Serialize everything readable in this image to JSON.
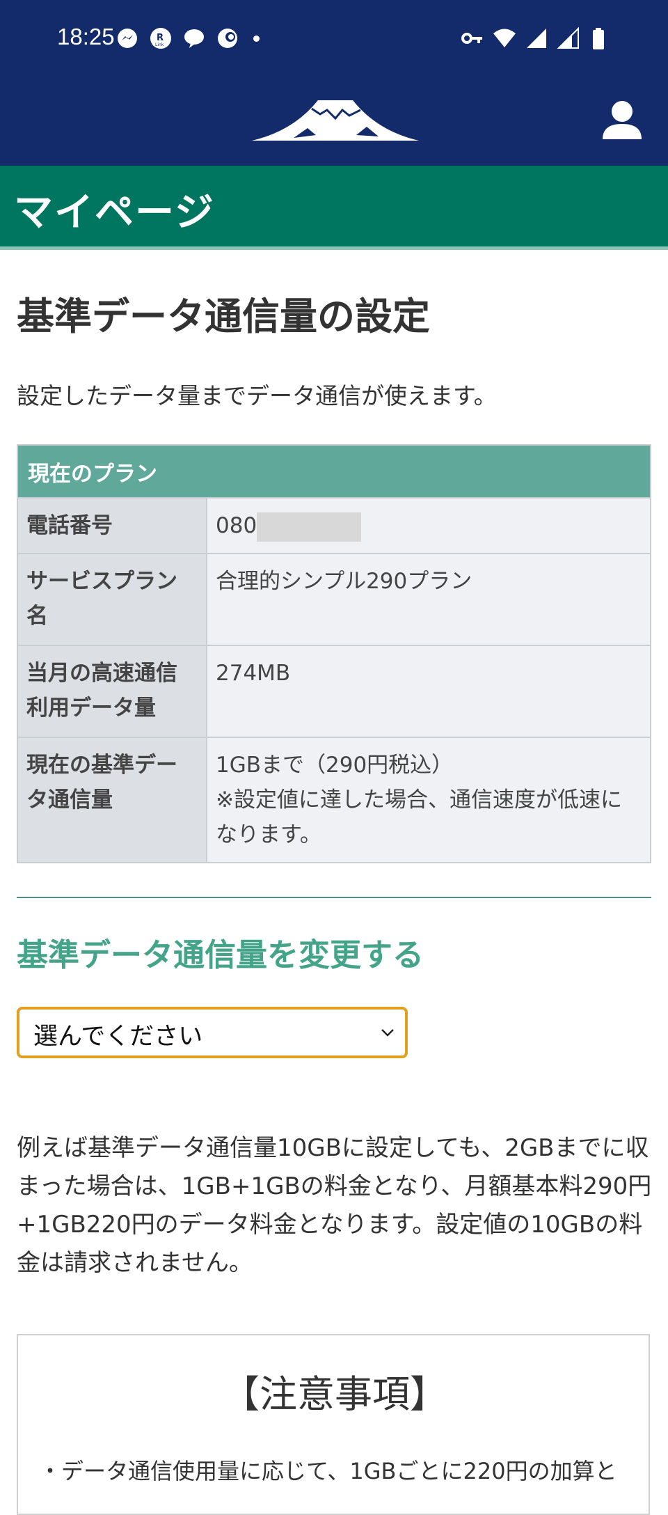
{
  "status_bar": {
    "time": "18:25",
    "left_icons": [
      "messenger-icon",
      "rakuten-link-icon",
      "chat-bubble-icon",
      "app-icon",
      "more-dot-icon"
    ],
    "right_icons": [
      "vpn-key-icon",
      "wifi-icon",
      "signal-icon",
      "signal-icon",
      "battery-icon"
    ]
  },
  "header": {
    "logo_icon": "mount-fuji-logo",
    "user_icon": "user-icon",
    "band_title": "マイページ"
  },
  "main": {
    "title": "基準データ通信量の設定",
    "intro": "設定したデータ量までデータ通信が使えます。",
    "plan_table": {
      "caption": "現在のプラン",
      "rows": [
        {
          "label": "電話番号",
          "value": "080"
        },
        {
          "label": "サービスプラン名",
          "value": "合理的シンプル290プラン"
        },
        {
          "label": "当月の高速通信利用データ量",
          "value": "274MB"
        },
        {
          "label": "現在の基準データ通信量",
          "value": "1GBまで（290円税込）",
          "note": "※設定値に達した場合、通信速度が低速になります。"
        }
      ]
    },
    "change_section": {
      "title": "基準データ通信量を変更する",
      "select_value": "選んでください"
    },
    "explanation": "例えば基準データ通信量10GBに設定しても、2GBまでに収まった場合は、1GB+1GBの料金となり、月額基本料290円+1GB220円のデータ料金となります。設定値の10GBの料金は請求されません。",
    "notice": {
      "title": "【注意事項】",
      "item1": "・データ通信使用量に応じて、1GBごとに220円の加算と"
    }
  },
  "colors": {
    "header_bg": "#142b6b",
    "band_bg": "#00755f",
    "table_caption_bg": "#5fa89a",
    "section_title": "#44a489",
    "select_border": "#e2a020"
  }
}
